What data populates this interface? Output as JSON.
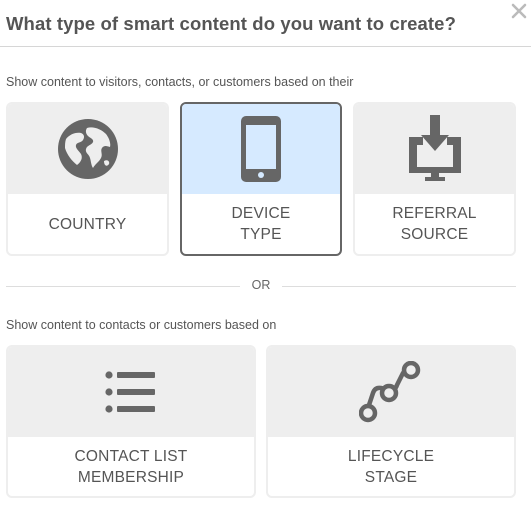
{
  "dialog": {
    "title": "What type of smart content do you want to create?",
    "close_icon": "close-icon"
  },
  "section_visitors": {
    "label": "Show content to visitors, contacts, or customers based on their",
    "cards": [
      {
        "label": "COUNTRY",
        "icon": "globe-icon",
        "selected": false
      },
      {
        "label": "DEVICE\nTYPE",
        "icon": "mobile-device-icon",
        "selected": true
      },
      {
        "label": "REFERRAL\nSOURCE",
        "icon": "download-to-screen-icon",
        "selected": false
      }
    ]
  },
  "divider": {
    "text": "OR"
  },
  "section_contacts": {
    "label": "Show content to contacts or customers based on",
    "cards": [
      {
        "label": "CONTACT LIST\nMEMBERSHIP",
        "icon": "list-icon",
        "selected": false
      },
      {
        "label": "LIFECYCLE\nSTAGE",
        "icon": "lifecycle-path-icon",
        "selected": false
      }
    ]
  },
  "colors": {
    "icon_gray": "#666666",
    "card_bg": "#eeeeee",
    "selected_bg": "#d6eaff",
    "selected_border": "#666666"
  }
}
